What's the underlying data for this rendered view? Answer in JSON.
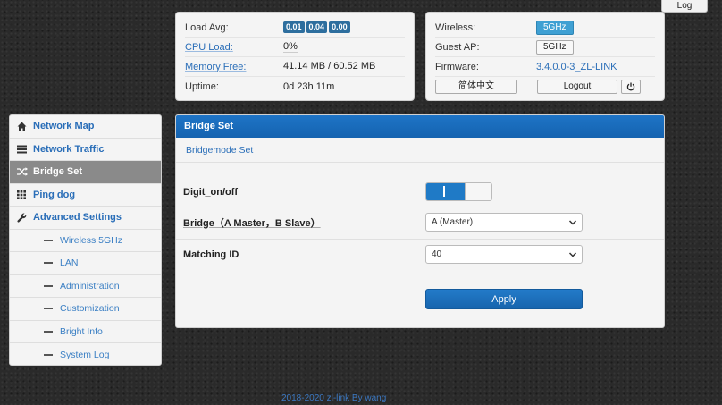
{
  "top": {
    "log_label": "Log"
  },
  "status_left": {
    "load_avg": {
      "label": "Load Avg:",
      "values": [
        "0.01",
        "0.04",
        "0.00"
      ]
    },
    "cpu_load": {
      "label": "CPU Load:",
      "value": "0%"
    },
    "memory_free": {
      "label": "Memory Free:",
      "value": "41.14 MB / 60.52 MB"
    },
    "uptime": {
      "label": "Uptime:",
      "value": "0d 23h 11m"
    }
  },
  "status_right": {
    "wireless": {
      "label": "Wireless:",
      "button": "5GHz"
    },
    "guest_ap": {
      "label": "Guest AP:",
      "button": "5GHz"
    },
    "firmware": {
      "label": "Firmware:",
      "value": "3.4.0.0-3_ZL-LINK"
    },
    "language_button": "简体中文",
    "logout_button": "Logout"
  },
  "sidebar": {
    "items": [
      {
        "label": "Network Map",
        "icon": "home-icon"
      },
      {
        "label": "Network Traffic",
        "icon": "list-icon"
      },
      {
        "label": "Bridge Set",
        "icon": "shuffle-icon",
        "active": true
      },
      {
        "label": "Ping dog",
        "icon": "grid-icon"
      },
      {
        "label": "Advanced Settings",
        "icon": "wrench-icon"
      }
    ],
    "subitems": [
      "Wireless 5GHz",
      "LAN",
      "Administration",
      "Customization",
      "Bright Info",
      "System Log"
    ]
  },
  "main": {
    "title": "Bridge Set",
    "subtitle": "Bridgemode Set",
    "fields": {
      "digit": {
        "label": "Digit_on/off",
        "state": "on"
      },
      "bridge": {
        "label": "Bridge（A Master，B Slave）",
        "value": "A (Master)"
      },
      "matching_id": {
        "label": "Matching ID",
        "value": "40"
      }
    },
    "apply_label": "Apply"
  },
  "footer": {
    "text": "2018-2020 zl-link By wang"
  },
  "colors": {
    "header_blue": "#1e74c6",
    "link_blue": "#2a6eb8",
    "active_nav": "#8a8a8a",
    "badge": "#2d6e9e",
    "wireless_active": "#3fa0d3"
  }
}
